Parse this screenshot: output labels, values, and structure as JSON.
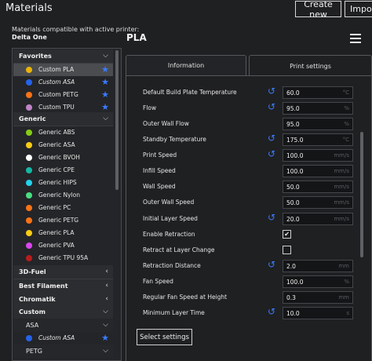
{
  "window": {
    "title": "Materials"
  },
  "header": {
    "create_new_label": "Create new",
    "import_label": "Import"
  },
  "compat": {
    "label": "Materials compatible with active printer:",
    "printer": "Delta One"
  },
  "sidebar": {
    "favorites": {
      "label": "Favorites",
      "items": [
        {
          "label": "Custom PLA",
          "color": "#eab308",
          "italic": false,
          "selected": true,
          "starred": true
        },
        {
          "label": "Custom ASA",
          "color": "#2563eb",
          "italic": true,
          "selected": false,
          "starred": true
        },
        {
          "label": "Custom PETG",
          "color": "#f97316",
          "italic": false,
          "selected": false,
          "starred": true
        },
        {
          "label": "Custom TPU",
          "color": "#c084c8",
          "italic": false,
          "selected": false,
          "starred": true
        }
      ]
    },
    "generic": {
      "label": "Generic",
      "items": [
        {
          "label": "Generic ABS",
          "color": "#84cc16"
        },
        {
          "label": "Generic ASA",
          "color": "#facc15"
        },
        {
          "label": "Generic BVOH",
          "color": "#ffffff"
        },
        {
          "label": "Generic CPE",
          "color": "#14b8a6"
        },
        {
          "label": "Generic HIPS",
          "color": "#22d3ee"
        },
        {
          "label": "Generic Nylon",
          "color": "#4ade80"
        },
        {
          "label": "Generic PC",
          "color": "#f97316"
        },
        {
          "label": "Generic PETG",
          "color": "#f97316"
        },
        {
          "label": "Generic PLA",
          "color": "#facc15"
        },
        {
          "label": "Generic PVA",
          "color": "#d946ef"
        },
        {
          "label": "Generic TPU 95A",
          "color": "#b91c1c"
        }
      ]
    },
    "collapsed_brands": [
      "3D-Fuel",
      "Best Filament",
      "Chromatik"
    ],
    "custom": {
      "label": "Custom",
      "asa": {
        "label": "ASA",
        "item": {
          "label": "Custom ASA",
          "color": "#2563eb"
        }
      },
      "petg": {
        "label": "PETG"
      }
    }
  },
  "material": {
    "name": "PLA"
  },
  "tabs": {
    "information": "Information",
    "print_settings": "Print settings"
  },
  "settings": [
    {
      "label": "Default Build Plate Temperature",
      "value": "60.0",
      "unit": "°C",
      "reset": true
    },
    {
      "label": "Flow",
      "value": "95.0",
      "unit": "%",
      "reset": true
    },
    {
      "label": "Outer Wall Flow",
      "value": "95.0",
      "unit": "%",
      "reset": false
    },
    {
      "label": "Standby Temperature",
      "value": "175.0",
      "unit": "°C",
      "reset": true
    },
    {
      "label": "Print Speed",
      "value": "100.0",
      "unit": "mm/s",
      "reset": true
    },
    {
      "label": "Infill Speed",
      "value": "100.0",
      "unit": "mm/s",
      "reset": false
    },
    {
      "label": "Wall Speed",
      "value": "50.0",
      "unit": "mm/s",
      "reset": false
    },
    {
      "label": "Outer Wall Speed",
      "value": "50.0",
      "unit": "mm/s",
      "reset": false
    },
    {
      "label": "Initial Layer Speed",
      "value": "20.0",
      "unit": "mm/s",
      "reset": true
    },
    {
      "label": "Enable Retraction",
      "checkbox": true,
      "checked": true,
      "reset": false
    },
    {
      "label": "Retract at Layer Change",
      "checkbox": true,
      "checked": false,
      "reset": false
    },
    {
      "label": "Retraction Distance",
      "value": "2.0",
      "unit": "mm",
      "reset": true
    },
    {
      "label": "Fan Speed",
      "value": "100.0",
      "unit": "%",
      "reset": false
    },
    {
      "label": "Regular Fan Speed at Height",
      "value": "0.3",
      "unit": "mm",
      "reset": false
    },
    {
      "label": "Minimum Layer Time",
      "value": "10.0",
      "unit": "s",
      "reset": true
    }
  ],
  "footer": {
    "select_settings_label": "Select settings"
  },
  "icons": {
    "reset": "reset-arrow-icon",
    "star": "star-icon",
    "menu": "hamburger-menu-icon",
    "chevron_down": "chevron-down-icon",
    "chevron_left": "chevron-left-icon",
    "check": "check-icon"
  },
  "colors": {
    "accent": "#3a7bff",
    "background": "#1f2022"
  }
}
